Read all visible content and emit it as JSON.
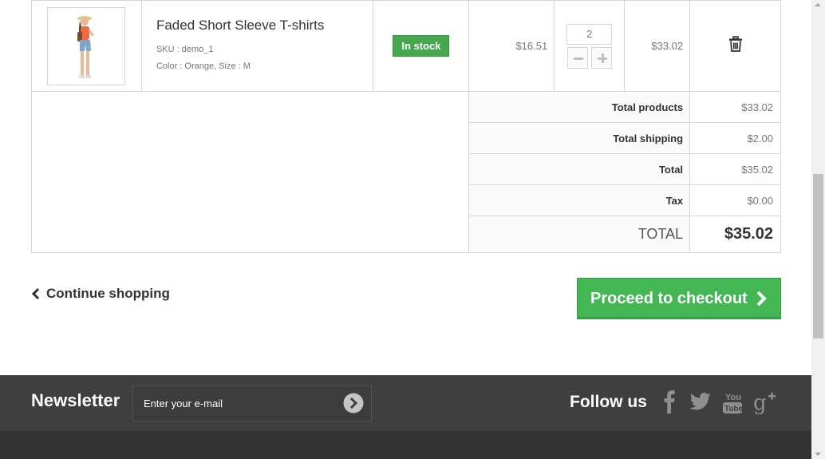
{
  "product": {
    "name": "Faded Short Sleeve T-shirts",
    "sku": "SKU : demo_1",
    "attributes": "Color : Orange, Size : M",
    "availability": "In stock",
    "unit_price": "$16.51",
    "quantity": "2",
    "total": "$33.02"
  },
  "summary": {
    "rows": [
      {
        "label": "Total products",
        "value": "$33.02"
      },
      {
        "label": "Total shipping",
        "value": "$2.00"
      },
      {
        "label": "Total",
        "value": "$35.02"
      },
      {
        "label": "Tax",
        "value": "$0.00"
      }
    ],
    "grand_label": "TOTAL",
    "grand_value": "$35.02"
  },
  "actions": {
    "continue_label": "Continue shopping",
    "checkout_label": "Proceed to checkout"
  },
  "footer": {
    "newsletter_title": "Newsletter",
    "newsletter_placeholder": "Enter your e-mail",
    "follow_title": "Follow us",
    "social": [
      "facebook-icon",
      "twitter-icon",
      "youtube-icon",
      "google-plus-icon"
    ]
  },
  "colors": {
    "in_stock": "#46a74e",
    "checkout": "#43b754",
    "footer": "#3f3f3f"
  }
}
